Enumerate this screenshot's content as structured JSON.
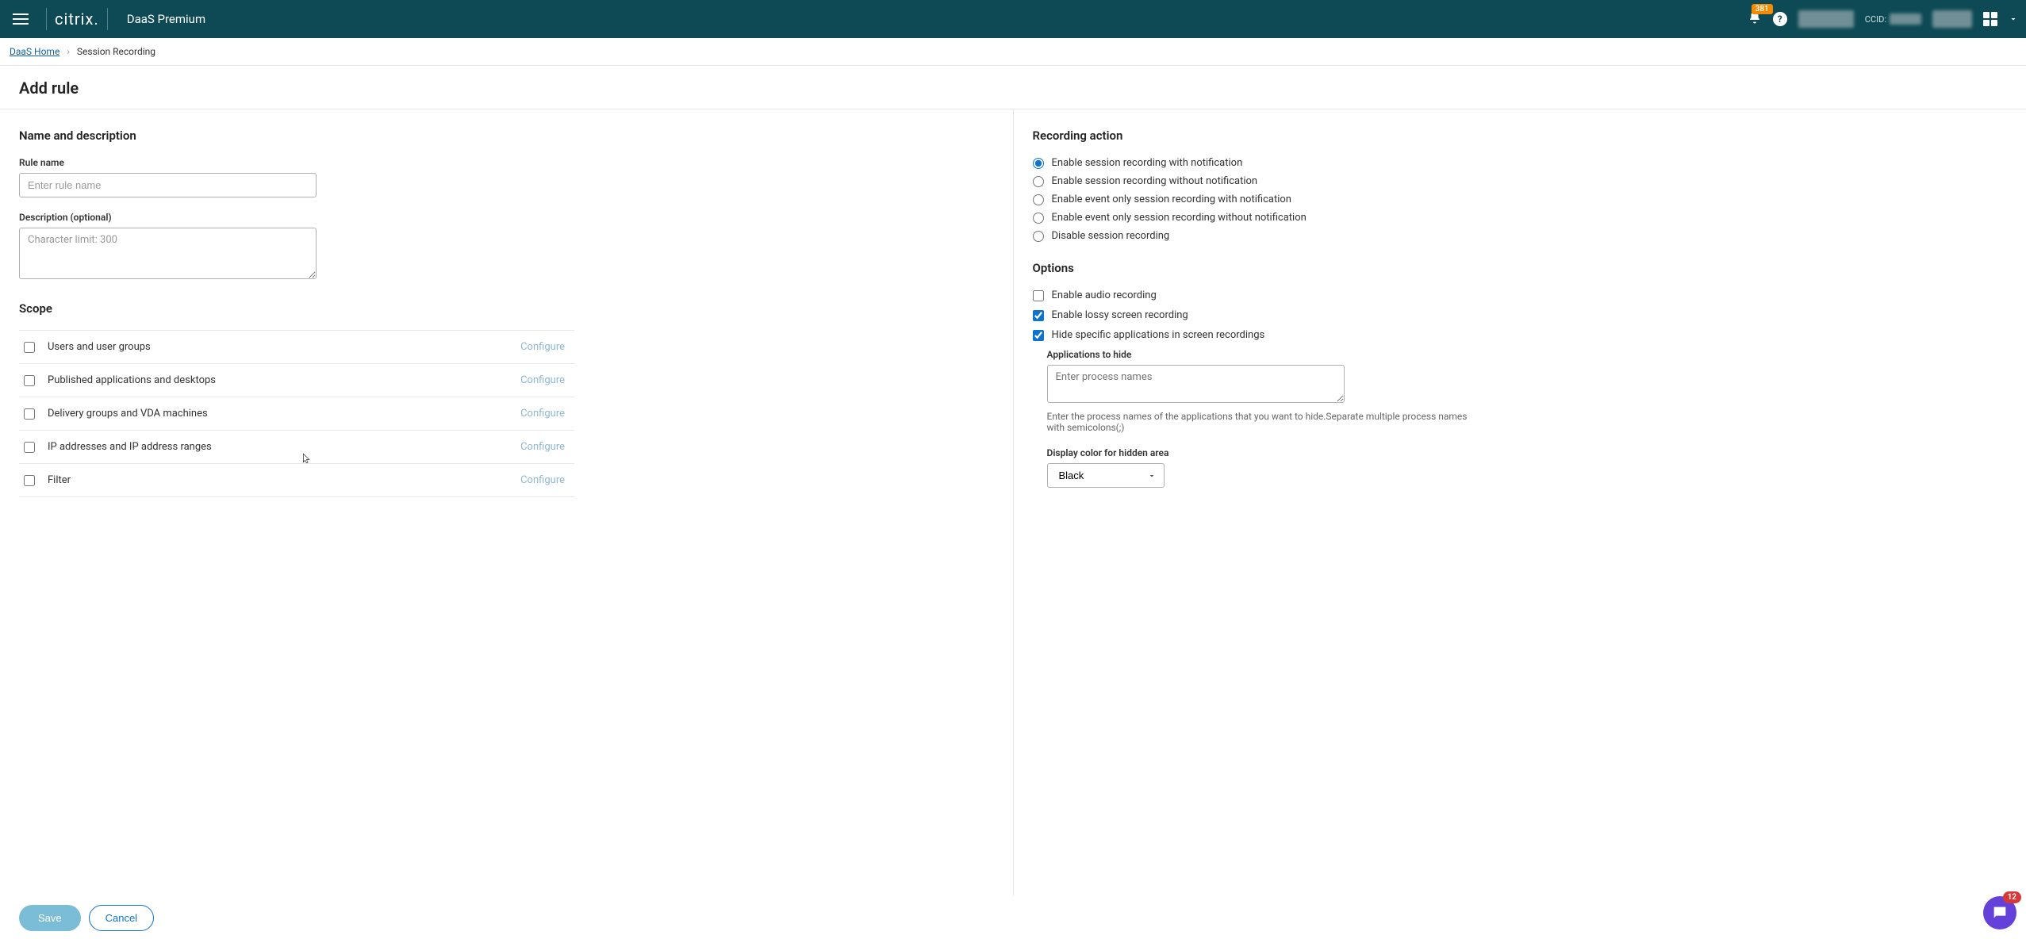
{
  "header": {
    "logo": "citrix",
    "product": "DaaS Premium",
    "notification_count": "381",
    "ccid_label": "CCID:"
  },
  "breadcrumb": {
    "home": "DaaS Home",
    "current": "Session Recording"
  },
  "page": {
    "title": "Add rule"
  },
  "left": {
    "section_name_desc": "Name and description",
    "rule_name_label": "Rule name",
    "rule_name_placeholder": "Enter rule name",
    "description_label": "Description (optional)",
    "description_placeholder": "Character limit: 300",
    "section_scope": "Scope",
    "scope_items": [
      {
        "label": "Users and user groups",
        "action": "Configure"
      },
      {
        "label": "Published applications and desktops",
        "action": "Configure"
      },
      {
        "label": "Delivery groups and VDA machines",
        "action": "Configure"
      },
      {
        "label": "IP addresses and IP address ranges",
        "action": "Configure"
      },
      {
        "label": "Filter",
        "action": "Configure"
      }
    ]
  },
  "right": {
    "section_action": "Recording action",
    "radios": [
      "Enable session recording with notification",
      "Enable session recording without notification",
      "Enable event only session recording with notification",
      "Enable event only session recording without notification",
      "Disable session recording"
    ],
    "section_options": "Options",
    "opt_audio": "Enable audio recording",
    "opt_lossy": "Enable lossy screen recording",
    "opt_hide": "Hide specific applications in screen recordings",
    "apps_to_hide_label": "Applications to hide",
    "apps_to_hide_placeholder": "Enter process names",
    "apps_hint": "Enter the process names of the applications that you want to hide.Separate multiple process names with semicolons(;)",
    "display_color_label": "Display color for hidden area",
    "display_color_value": "Black"
  },
  "footer": {
    "save": "Save",
    "cancel": "Cancel"
  },
  "chat": {
    "badge": "12"
  }
}
